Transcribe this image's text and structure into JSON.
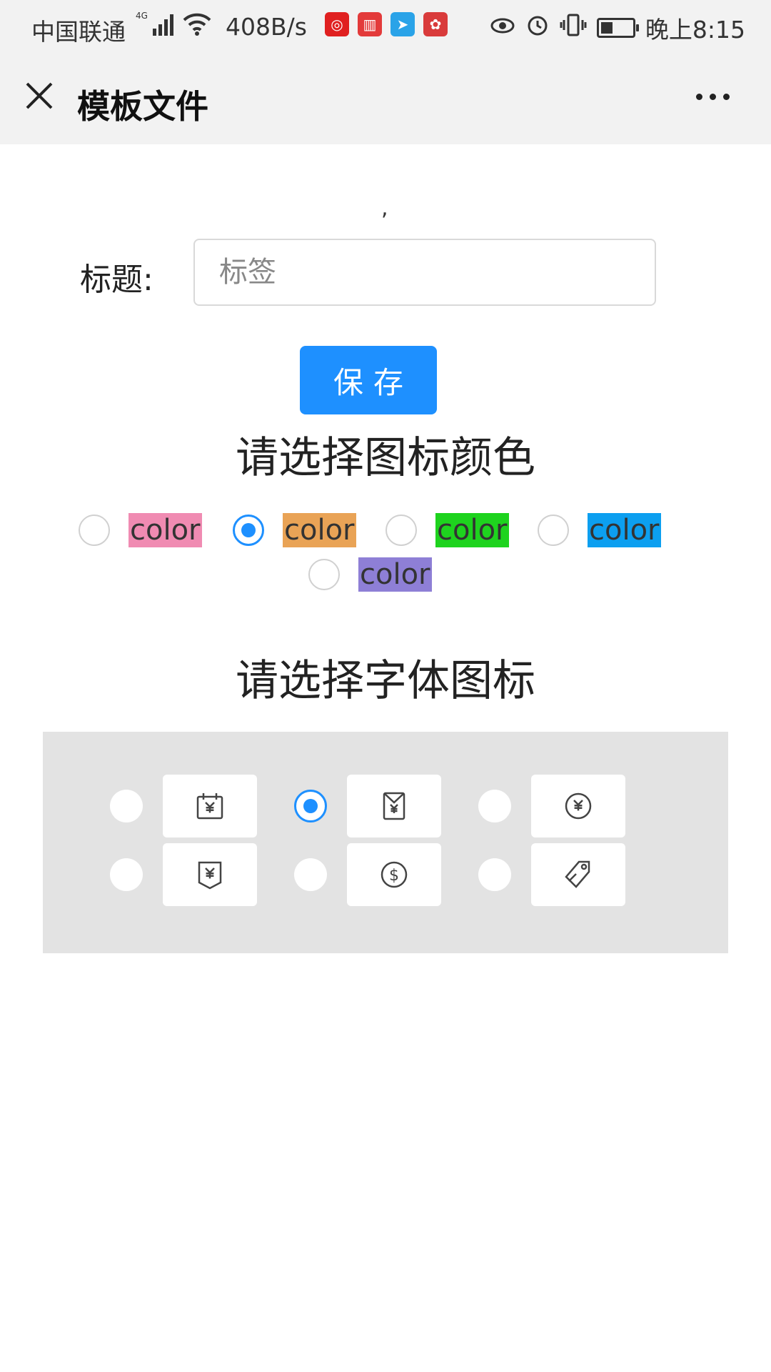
{
  "status_bar": {
    "carrier": "中国联通",
    "network": "4G",
    "speed": "408B/s",
    "apps": [
      "netease-music-icon",
      "reader-icon",
      "mail-icon",
      "huawei-icon"
    ],
    "battery_level": 0.45,
    "time": "晚上8:15"
  },
  "header": {
    "title": "模板文件"
  },
  "stray_text": ",",
  "form": {
    "title_label": "标题:",
    "title_value": "",
    "title_placeholder": "标签",
    "save_label": "保存"
  },
  "color_section": {
    "heading": "请选择图标颜色",
    "options": [
      {
        "label": "color",
        "color": "#f08bb2",
        "checked": false
      },
      {
        "label": "color",
        "color": "#e9a356",
        "checked": true
      },
      {
        "label": "color",
        "color": "#1ed31e",
        "checked": false
      },
      {
        "label": "color",
        "color": "#0c9ff0",
        "checked": false
      },
      {
        "label": "color",
        "color": "#8e7fd6",
        "checked": false
      }
    ]
  },
  "icon_section": {
    "heading": "请选择字体图标",
    "options": [
      {
        "icon": "calendar-yen-icon",
        "checked": false
      },
      {
        "icon": "envelope-yen-icon",
        "checked": true
      },
      {
        "icon": "yen-circle-icon",
        "checked": false
      },
      {
        "icon": "badge-yen-icon",
        "checked": false
      },
      {
        "icon": "dollar-circle-icon",
        "checked": false
      },
      {
        "icon": "price-tag-icon",
        "checked": false
      }
    ]
  }
}
